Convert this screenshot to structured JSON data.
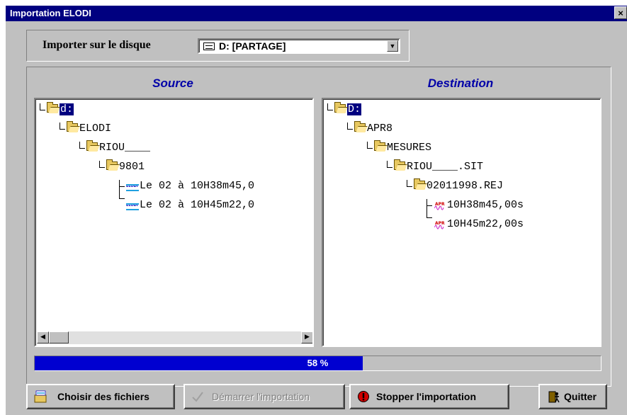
{
  "window": {
    "title": "Importation ELODI",
    "close_label": "×"
  },
  "disk": {
    "label": "Importer sur le disque",
    "selected": "D: [PARTAGE]",
    "icon": "drive-icon"
  },
  "source": {
    "title": "Source",
    "tree": [
      "d:",
      "ELODI",
      "RIOU____",
      "9801",
      "Le 02 à 10H38m45,0",
      "Le 02 à 10H45m22,0"
    ]
  },
  "destination": {
    "title": "Destination",
    "tree": [
      "D:",
      "APR8",
      "MESURES",
      "RIOU____.SIT",
      "02011998.REJ",
      "10H38m45,00s",
      "10H45m22,00s"
    ]
  },
  "progress": {
    "value": 58,
    "label": "58 %"
  },
  "buttons": {
    "choose": "Choisir des fichiers",
    "start": "Démarrer l'importation",
    "stop": "Stopper l'importation",
    "quit": "Quitter"
  },
  "colors": {
    "titlebar": "#000080",
    "progress": "#0000d0",
    "pane_title": "#0000a8",
    "selection": "#000080"
  }
}
